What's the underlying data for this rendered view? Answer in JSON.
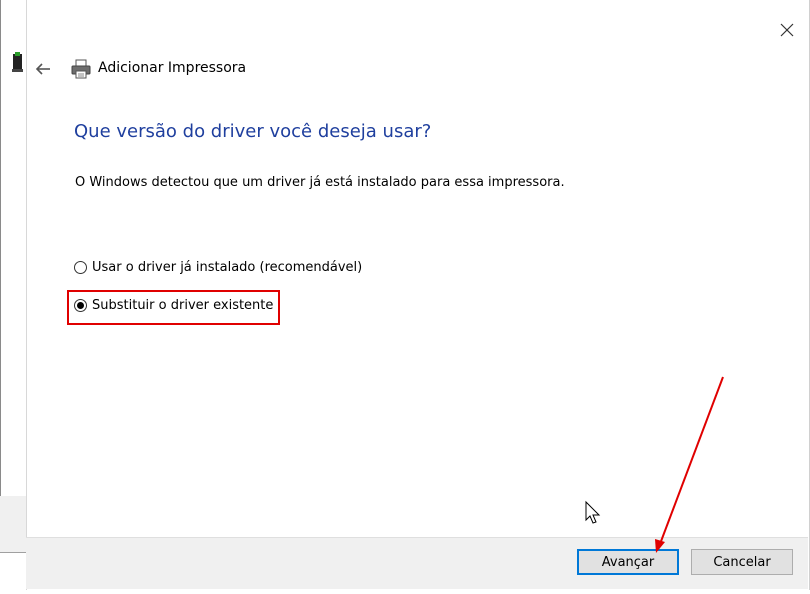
{
  "window": {
    "title": "Adicionar Impressora",
    "close_icon": "close-icon",
    "back_icon": "back-arrow-icon",
    "title_icon": "printer-icon"
  },
  "content": {
    "heading": "Que versão do driver você deseja usar?",
    "description": "O Windows detectou que um driver já está instalado para essa impressora.",
    "options": [
      {
        "label": "Usar o driver já instalado (recomendável)",
        "selected": false
      },
      {
        "label": "Substituir o driver existente",
        "selected": true
      }
    ]
  },
  "footer": {
    "next_label": "Avançar",
    "cancel_label": "Cancelar"
  },
  "annotations": {
    "highlight_color": "#e00000",
    "arrow_color": "#e00000"
  }
}
